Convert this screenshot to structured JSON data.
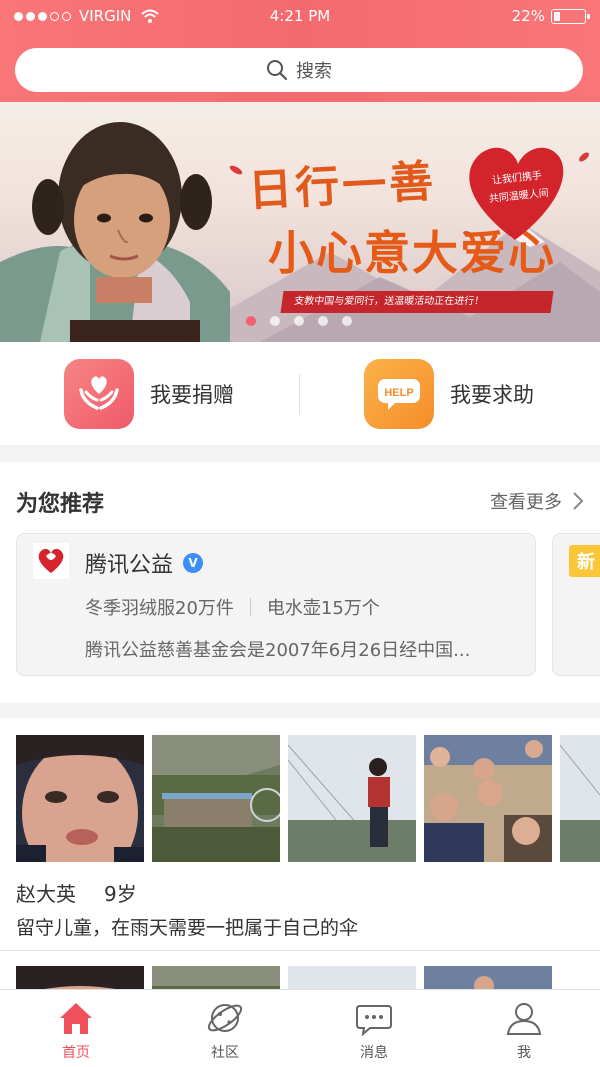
{
  "status": {
    "carrier": "VIRGIN",
    "time": "4:21 PM",
    "battery": "22%",
    "battery_level": 0.22
  },
  "search": {
    "placeholder": "搜索"
  },
  "banner": {
    "slogan_line1": "日行一善",
    "slogan_line2": "小心意大爱心",
    "tagline": "支教中国与爱同行，送温暖活动正在进行！",
    "heart_text_1": "让我们携手",
    "heart_text_2": "共同温暖人间",
    "pages": 5,
    "active_page": 0
  },
  "actions": {
    "donate": {
      "label": "我要捐赠",
      "icon": "heart-hands-icon"
    },
    "help": {
      "label": "我要求助",
      "icon": "help-bubble-icon",
      "icon_text": "HELP"
    }
  },
  "recommend": {
    "title": "为您推荐",
    "more": "查看更多",
    "card": {
      "name": "腾讯公益",
      "verified_mark": "V",
      "tag1": "冬季羽绒服20万件",
      "tag2": "电水壶15万个",
      "description": "腾讯公益慈善基金会是2007年6月26日经中国..."
    },
    "next_card_badge": "新"
  },
  "story": {
    "name": "赵大英",
    "age": "9岁",
    "description": "留守儿童，在雨天需要一把属于自己的伞"
  },
  "tabs": [
    {
      "label": "首页",
      "icon": "home-icon",
      "active": true
    },
    {
      "label": "社区",
      "icon": "planet-icon",
      "active": false
    },
    {
      "label": "消息",
      "icon": "chat-icon",
      "active": false
    },
    {
      "label": "我",
      "icon": "user-icon",
      "active": false
    }
  ],
  "colors": {
    "accent": "#f36a6f",
    "help": "#f68d2a",
    "badge": "#fbc638"
  }
}
